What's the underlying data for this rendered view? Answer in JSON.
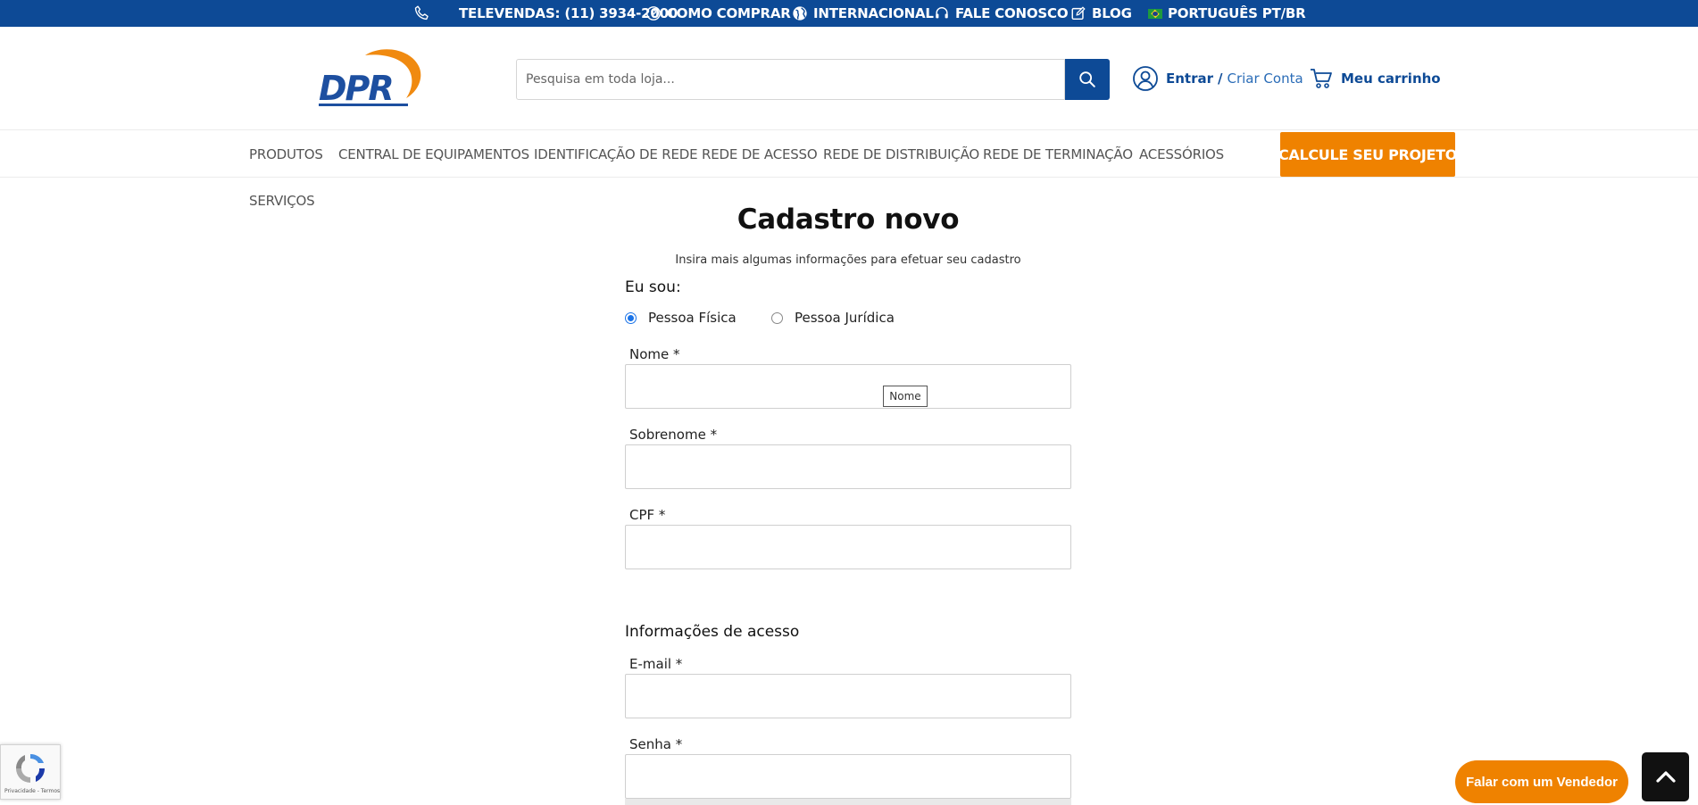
{
  "topbar": {
    "phone": "TELEVENDAS: (11) 3934-2000",
    "how_to_buy": "COMO COMPRAR",
    "international": "INTERNACIONAL",
    "contact": "FALE CONOSCO",
    "blog": "BLOG",
    "language": "PORTUGUÊS PT/BR"
  },
  "header": {
    "logo_text": "DPR",
    "search_placeholder": "Pesquisa em toda loja...",
    "login": "Entrar",
    "login_sep": "/",
    "create_account": "Criar Conta",
    "cart": "Meu carrinho"
  },
  "nav": {
    "items": [
      "PRODUTOS",
      "CENTRAL DE EQUIPAMENTOS",
      "IDENTIFICAÇÃO DE REDE",
      "REDE DE ACESSO",
      "REDE DE DISTRIBUIÇÃO",
      "REDE DE TERMINAÇÃO",
      "ACESSÓRIOS",
      "SERVIÇOS"
    ],
    "cta": "CALCULE SEU PROJETO"
  },
  "form": {
    "title": "Cadastro novo",
    "subtitle": "Insira mais algumas informações para efetuar seu cadastro",
    "person_type_label": "Eu sou:",
    "person_type_options": [
      "Pessoa Física",
      "Pessoa Jurídica"
    ],
    "person_type_selected": "Pessoa Física",
    "first_name_label": "Nome *",
    "first_name_tooltip": "Nome",
    "last_name_label": "Sobrenome *",
    "cpf_label": "CPF *",
    "access_section_title": "Informações de acesso",
    "email_label": "E-mail *",
    "password_label": "Senha *"
  },
  "floating": {
    "recaptcha_text": "Privacidade - Termos",
    "talk_to_seller": "Falar com um Vendedor"
  },
  "colors": {
    "brand_blue": "#0d4a96",
    "accent_orange": "#ef8200"
  }
}
